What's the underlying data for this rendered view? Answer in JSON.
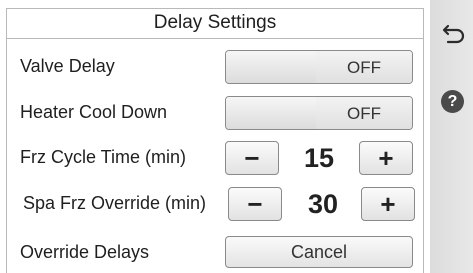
{
  "panel": {
    "title": "Delay Settings"
  },
  "rows": [
    {
      "label": "Valve Delay",
      "control": "toggle",
      "state": "OFF"
    },
    {
      "label": "Heater Cool Down",
      "control": "toggle",
      "state": "OFF"
    },
    {
      "label": "Frz Cycle Time (min)",
      "control": "stepper",
      "minus": "−",
      "value": "15",
      "plus": "+"
    },
    {
      "label": "Spa Frz Override (min)",
      "control": "stepper",
      "minus": "−",
      "value": "30",
      "plus": "+"
    },
    {
      "label": "Override Delays",
      "control": "button",
      "button_label": "Cancel"
    }
  ],
  "sidebar": {
    "back_icon": "back-arrow-icon",
    "help_icon": "help-icon",
    "help_glyph": "?"
  },
  "colors": {
    "border": "#8a8a8a",
    "sidebar_bg": "#e0e0e0",
    "text": "#1f1f1f",
    "help_icon_bg": "#4a4a4a"
  }
}
